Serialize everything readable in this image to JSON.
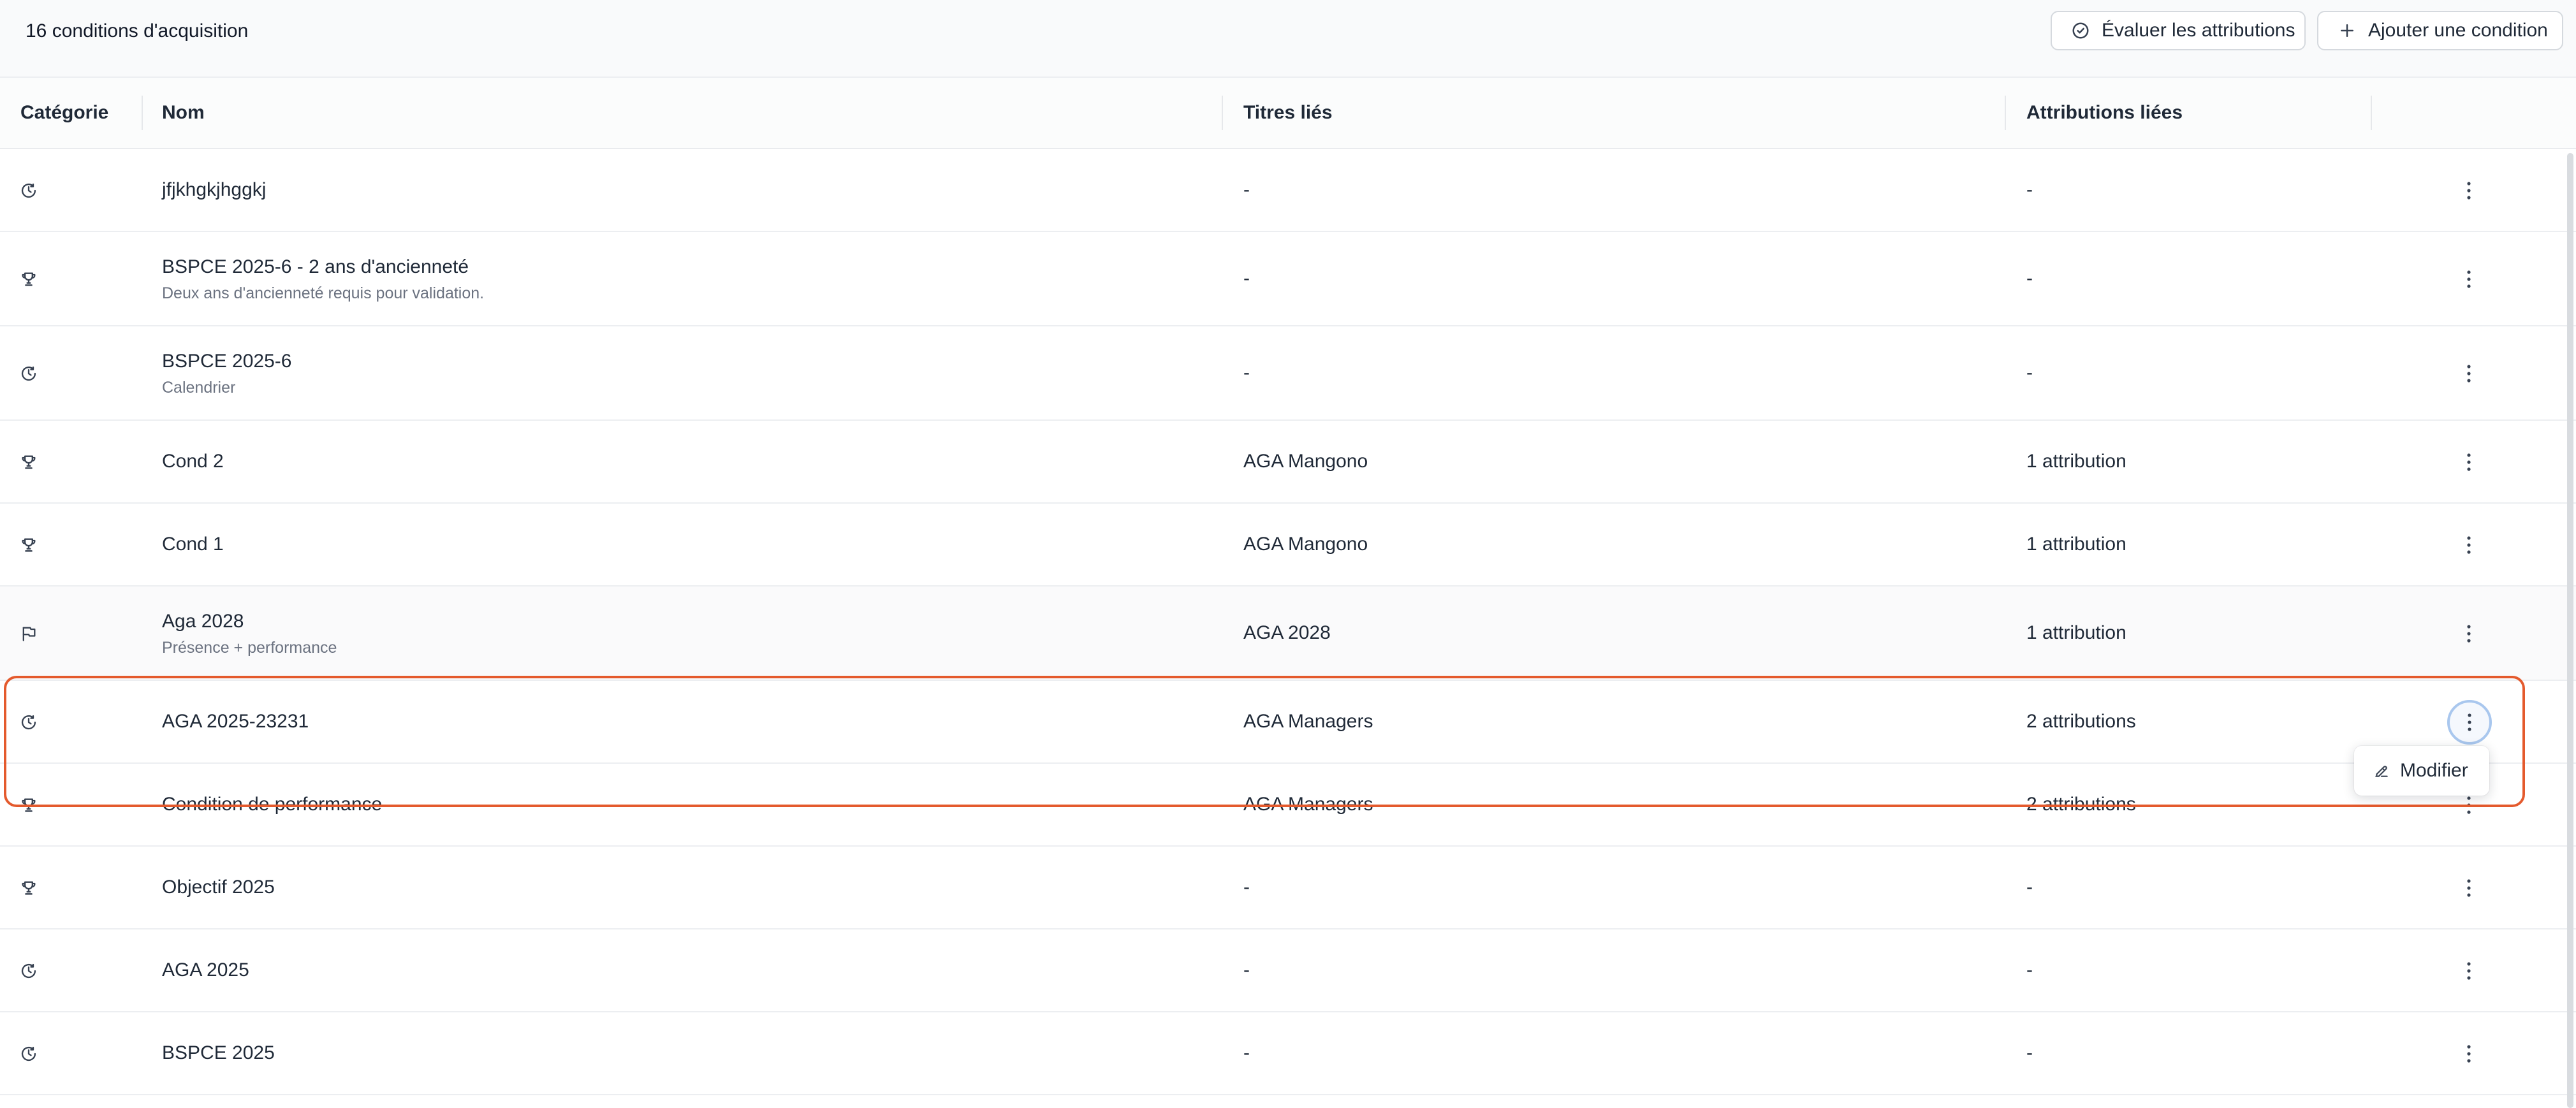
{
  "toolbar": {
    "title": "16 conditions d'acquisition",
    "evaluate_label": "Évaluer les attributions",
    "add_label": "Ajouter une condition"
  },
  "columns": {
    "category": "Catégorie",
    "name": "Nom",
    "titles": "Titres liés",
    "attributions": "Attributions liées"
  },
  "rows": [
    {
      "category_icon": "clock-icon",
      "name": "jfjkhgkjhggkj",
      "subtitle": "",
      "titles": "-",
      "attributions": "-"
    },
    {
      "category_icon": "trophy-icon",
      "name": "BSPCE 2025-6 - 2 ans d'ancienneté",
      "subtitle": "Deux ans d'ancienneté requis pour validation.",
      "titles": "-",
      "attributions": "-"
    },
    {
      "category_icon": "clock-icon",
      "name": "BSPCE 2025-6",
      "subtitle": "Calendrier",
      "titles": "-",
      "attributions": "-"
    },
    {
      "category_icon": "trophy-icon",
      "name": "Cond 2",
      "subtitle": "",
      "titles": "AGA Mangono",
      "attributions": "1 attribution"
    },
    {
      "category_icon": "trophy-icon",
      "name": "Cond 1",
      "subtitle": "",
      "titles": "AGA Mangono",
      "attributions": "1 attribution"
    },
    {
      "category_icon": "flag-icon",
      "name": "Aga 2028",
      "subtitle": "Présence + performance",
      "titles": "AGA 2028",
      "attributions": "1 attribution"
    },
    {
      "category_icon": "clock-icon",
      "name": "AGA 2025-23231",
      "subtitle": "",
      "titles": "AGA Managers",
      "attributions": "2 attributions"
    },
    {
      "category_icon": "trophy-icon",
      "name": "Condition de performance",
      "subtitle": "",
      "titles": "AGA Managers",
      "attributions": "2 attributions"
    },
    {
      "category_icon": "trophy-icon",
      "name": "Objectif 2025",
      "subtitle": "",
      "titles": "-",
      "attributions": "-"
    },
    {
      "category_icon": "clock-icon",
      "name": "AGA 2025",
      "subtitle": "",
      "titles": "-",
      "attributions": "-"
    },
    {
      "category_icon": "clock-icon",
      "name": "BSPCE 2025",
      "subtitle": "",
      "titles": "-",
      "attributions": "-"
    }
  ],
  "menu": {
    "edit_label": "Modifier"
  },
  "colors": {
    "highlight": "#e45a2d",
    "focus_ring": "#a9c7ee"
  }
}
